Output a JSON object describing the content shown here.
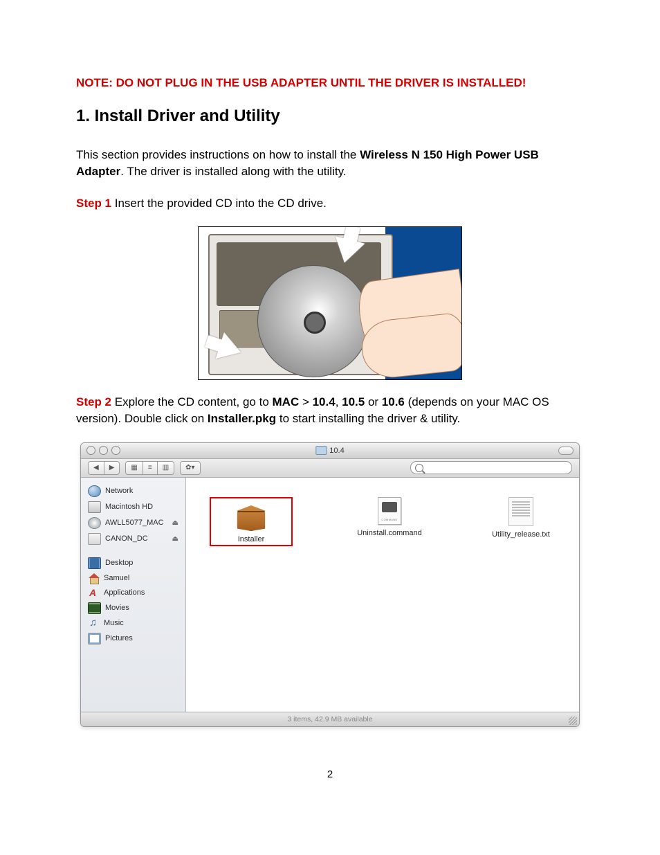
{
  "note": "NOTE: DO NOT PLUG IN THE USB ADAPTER UNTIL THE DRIVER IS INSTALLED!",
  "heading": "1. Install Driver and Utility",
  "intro_pre": "This section provides instructions on how to install the ",
  "intro_bold": "Wireless N 150 High Power USB Adapter",
  "intro_post": ". The driver is installed along with the utility.",
  "step1_label": "Step 1",
  "step1_text": " Insert the provided CD into the CD drive.",
  "step2_label": "Step 2",
  "step2_a": " Explore the CD content, go to ",
  "step2_mac": "MAC",
  "step2_gt": " > ",
  "step2_v1": "10.4",
  "step2_c1": ", ",
  "step2_v2": "10.5",
  "step2_or": " or ",
  "step2_v3": "10.6",
  "step2_b": " (depends on your MAC OS version). Double click on ",
  "step2_pkg": "Installer.pkg",
  "step2_c": " to start installing the driver & utility.",
  "finder": {
    "title": "10.4",
    "sidebar": {
      "devices": [
        {
          "label": "Network",
          "icon": "network",
          "eject": false
        },
        {
          "label": "Macintosh HD",
          "icon": "hdd",
          "eject": false
        },
        {
          "label": "AWLL5077_MAC",
          "icon": "cd",
          "eject": true
        },
        {
          "label": "CANON_DC",
          "icon": "fw",
          "eject": true
        }
      ],
      "places": [
        {
          "label": "Desktop",
          "icon": "desktop"
        },
        {
          "label": "Samuel",
          "icon": "home"
        },
        {
          "label": "Applications",
          "icon": "apps"
        },
        {
          "label": "Movies",
          "icon": "movies"
        },
        {
          "label": "Music",
          "icon": "music"
        },
        {
          "label": "Pictures",
          "icon": "pictures"
        }
      ]
    },
    "files": [
      {
        "label": "Installer",
        "type": "pkg",
        "highlighted": true
      },
      {
        "label": "Uninstall.command",
        "type": "cmd",
        "highlighted": false
      },
      {
        "label": "Utility_release.txt",
        "type": "txt",
        "highlighted": false
      }
    ],
    "status": "3 items, 42.9 MB available"
  },
  "page_number": "2"
}
